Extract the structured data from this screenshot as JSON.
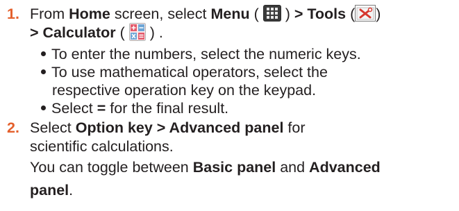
{
  "colors": {
    "accent": "#e4602c",
    "text": "#231f20"
  },
  "step1": {
    "number": "1.",
    "line1": {
      "t1": "From ",
      "home": "Home",
      "t2": " screen, select ",
      "menu": "Menu",
      "t3": " ( ",
      "t4": " ) ",
      "tools": "> Tools",
      "t5": " (",
      "t6": ")"
    },
    "line2": {
      "calc": "> Calculator",
      "t1": " ( ",
      "t2": " ) ."
    },
    "bullets": [
      "To enter the numbers, select the numeric keys.",
      "To use mathematical operators, select the",
      "Select "
    ],
    "bullet2_cont": "respective operation key on the keypad.",
    "bullet3_equals": "=",
    "bullet3_rest": " for the final result."
  },
  "step2": {
    "number": "2.",
    "line1_t1": "Select ",
    "option_key": "Option key > Advanced panel",
    "line1_t2": " for",
    "line2": "scientific calculations.",
    "line3_t1": "You can toggle between ",
    "basic_panel": "Basic panel",
    "line3_t2": " and ",
    "advanced": "Advanced",
    "line4": "panel",
    "line4_t2": "."
  }
}
